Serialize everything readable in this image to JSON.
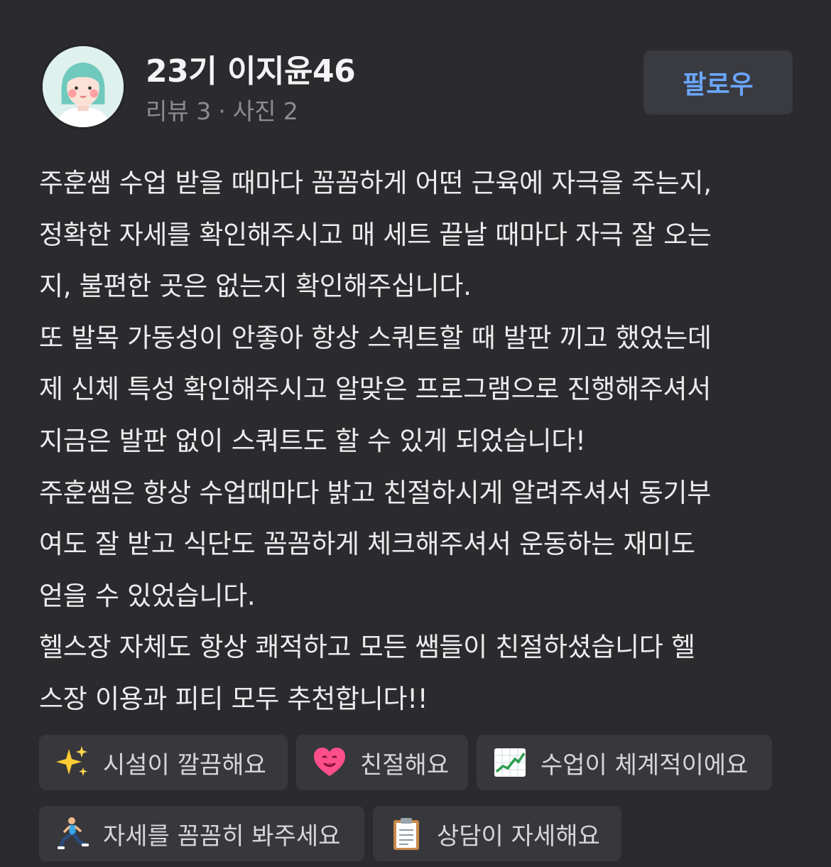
{
  "profile": {
    "username": "23기 이지윤46",
    "reviews_label": "리뷰 3",
    "separator": "·",
    "photos_label": "사진 2",
    "follow_label": "팔로우"
  },
  "review": {
    "lines": [
      "주훈쌤 수업 받을 때마다 꼼꼼하게 어떤 근육에 자극을 주는지,",
      "정확한 자세를 확인해주시고 매 세트 끝날 때마다 자극 잘 오는",
      "지, 불편한 곳은 없는지 확인해주십니다.",
      "또 발목 가동성이 안좋아 항상 스쿼트할 때 발판 끼고 했었는데",
      "제 신체 특성 확인해주시고 알맞은 프로그램으로 진행해주셔서",
      "지금은 발판 없이 스쿼트도 할 수 있게 되었습니다!",
      "주훈쌤은 항상 수업때마다 밝고 친절하시게 알려주셔서 동기부",
      "여도 잘 받고 식단도 꼼꼼하게 체크해주셔서 운동하는 재미도",
      "얻을 수 있었습니다.",
      "헬스장 자체도 항상 쾌적하고 모든 쌤들이 친절하셨습니다 헬",
      "스장 이용과 피티 모두 추천합니다!!"
    ]
  },
  "tags": [
    {
      "icon": "sparkles-icon",
      "label": "시설이 깔끔해요"
    },
    {
      "icon": "heart-smile-icon",
      "label": "친절해요"
    },
    {
      "icon": "chart-up-icon",
      "label": "수업이 체계적이에요"
    },
    {
      "icon": "lunge-person-icon",
      "label": "자세를 꼼꼼히 봐주세요"
    },
    {
      "icon": "clipboard-icon",
      "label": "상담이 자세해요"
    }
  ]
}
